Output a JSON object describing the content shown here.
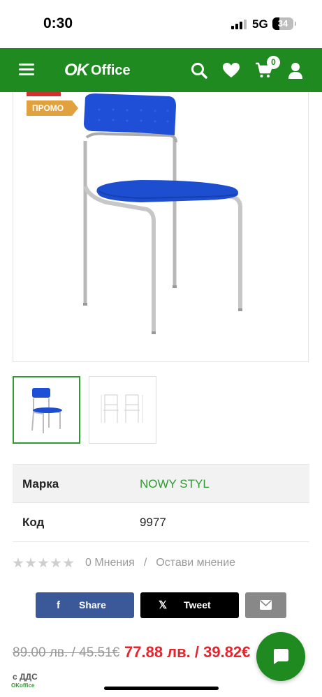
{
  "status_bar": {
    "time": "0:30",
    "network": "5G",
    "battery": "34"
  },
  "header": {
    "logo_mark": "OK",
    "logo_word": "Office",
    "cart_count": "0",
    "colors": {
      "brand_green": "#1f8a1f"
    }
  },
  "product": {
    "promo_label": "ПРОМО",
    "specs": [
      {
        "key": "Марка",
        "value": "NOWY STYL"
      },
      {
        "key": "Код",
        "value": "9977"
      }
    ],
    "rating": {
      "stars": 0,
      "max_stars": 5,
      "reviews_label": "0 Мнения",
      "separator": "/",
      "write_review": "Остави мнение"
    },
    "share": {
      "facebook_label": "Share",
      "twitter_label": "Tweet"
    },
    "price": {
      "old": "89.00 лв. / 45.51€",
      "new": "77.88 лв. / 39.82€",
      "vat_note": "с ДДС"
    }
  },
  "footer": {
    "mini_logo": "OKoffice"
  }
}
